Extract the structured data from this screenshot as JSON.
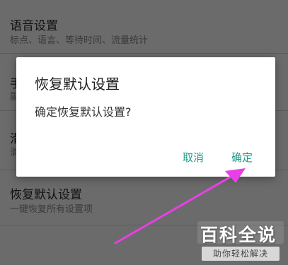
{
  "settings": {
    "items": [
      {
        "title": "语音设置",
        "subtitle": "标点、语言、等待时间、流量统计"
      },
      {
        "title": "手",
        "subtitle": "副"
      },
      {
        "title": "滑",
        "subtitle": "滑"
      },
      {
        "title": "恢复默认设置",
        "subtitle": "一键恢复所有设置项"
      }
    ]
  },
  "dialog": {
    "title": "恢复默认设置",
    "message": "确定恢复默认设置?",
    "cancel_label": "取消",
    "confirm_label": "确定",
    "button_color": "#1a9a8a"
  },
  "annotation": {
    "arrow_color": "#e93fe6"
  },
  "watermark": {
    "title": "百科全说",
    "subtitle": "助你轻松解决"
  }
}
